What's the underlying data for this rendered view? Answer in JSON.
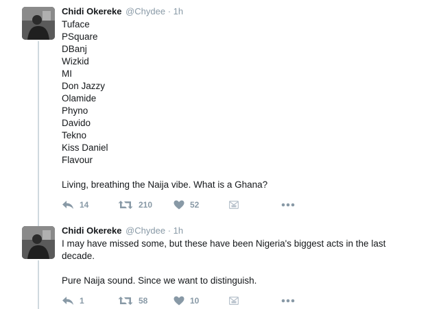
{
  "tweets": [
    {
      "author_name": "Chidi Okereke",
      "author_handle": "@Chydee",
      "separator": "·",
      "time": "1h",
      "body_lines": [
        "Tuface",
        "PSquare",
        "DBanj",
        "Wizkid",
        "MI",
        "Don Jazzy",
        "Olamide",
        "Phyno",
        "Davido",
        "Tekno",
        "Kiss Daniel",
        "Flavour",
        "",
        "Living, breathing the Naija vibe. What is a Ghana?"
      ],
      "reply_count": "14",
      "retweet_count": "210",
      "like_count": "52",
      "icons": {
        "reply": "reply-icon",
        "retweet": "retweet-icon",
        "like": "heart-icon",
        "dm": "direct-message-icon",
        "more": "more-icon"
      }
    },
    {
      "author_name": "Chidi Okereke",
      "author_handle": "@Chydee",
      "separator": "·",
      "time": "1h",
      "body_lines": [
        "I may have missed some, but these have been Nigeria's biggest acts in the last",
        "decade.",
        "",
        "Pure Naija sound. Since we want to distinguish."
      ],
      "reply_count": "1",
      "retweet_count": "58",
      "like_count": "10",
      "icons": {
        "reply": "reply-icon",
        "retweet": "retweet-icon",
        "like": "heart-icon",
        "dm": "direct-message-icon",
        "more": "more-icon"
      }
    }
  ],
  "colors": {
    "text": "#14171a",
    "muted": "#8899a6",
    "thread_line": "#cfd9de"
  }
}
